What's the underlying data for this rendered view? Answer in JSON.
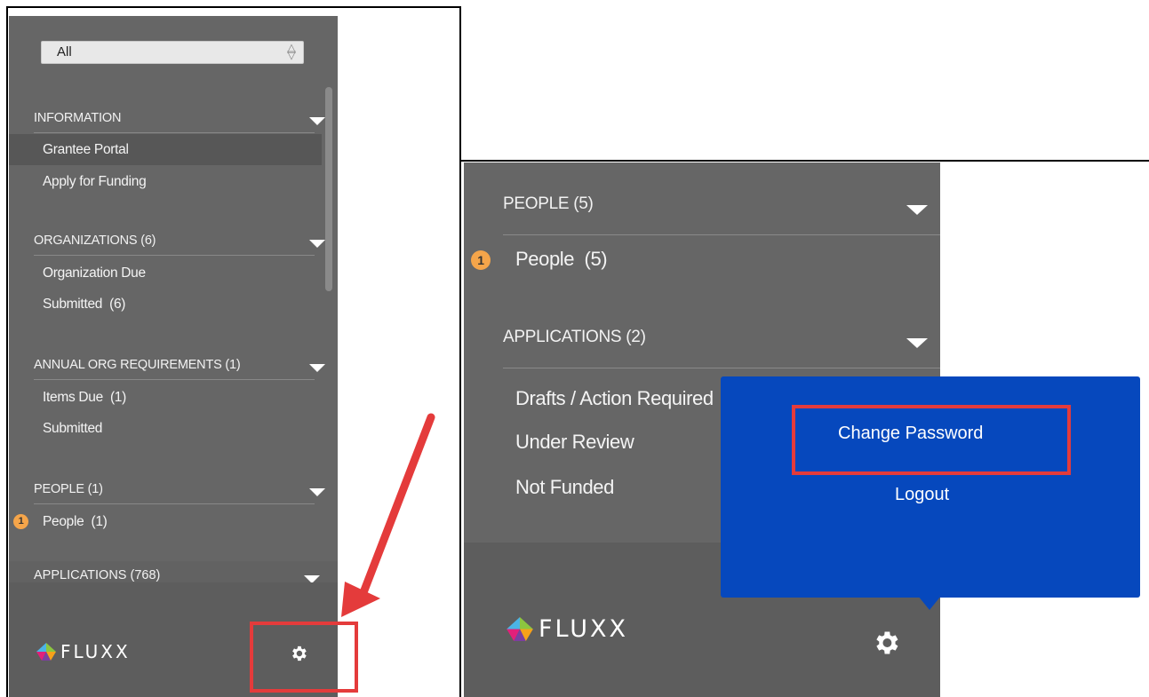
{
  "left_panel": {
    "filter": {
      "selected": "All"
    },
    "sections": [
      {
        "header": "INFORMATION",
        "items": [
          {
            "label": "Grantee Portal",
            "active": true
          },
          {
            "label": "Apply for Funding"
          }
        ]
      },
      {
        "header": "ORGANIZATIONS (6)",
        "items": [
          {
            "label": "Organization Due"
          },
          {
            "label": "Submitted  (6)"
          }
        ]
      },
      {
        "header": "ANNUAL ORG REQUIREMENTS (1)",
        "items": [
          {
            "label": "Items Due  (1)"
          },
          {
            "label": "Submitted"
          }
        ]
      },
      {
        "header": "PEOPLE (1)",
        "items": [
          {
            "label": "People  (1)",
            "badge": "1"
          }
        ]
      },
      {
        "header": "APPLICATIONS (768)",
        "items": []
      }
    ],
    "logo_text": "FLUXX"
  },
  "right_panel": {
    "sections": [
      {
        "header": "PEOPLE (5)",
        "items": [
          {
            "label": "People  (5)",
            "badge": "1"
          }
        ]
      },
      {
        "header": "APPLICATIONS (2)",
        "items": [
          {
            "label": "Drafts / Action Required"
          },
          {
            "label": "Under Review"
          },
          {
            "label": "Not Funded"
          }
        ]
      }
    ],
    "logo_text": "FLUXX",
    "popup": {
      "change_password": "Change Password",
      "logout": "Logout"
    }
  },
  "colors": {
    "panel_bg": "#666666",
    "footer_bg": "#5d5d5d",
    "popup_bg": "#0648bd",
    "highlight": "#e43b3b",
    "badge": "#f5a54a"
  }
}
